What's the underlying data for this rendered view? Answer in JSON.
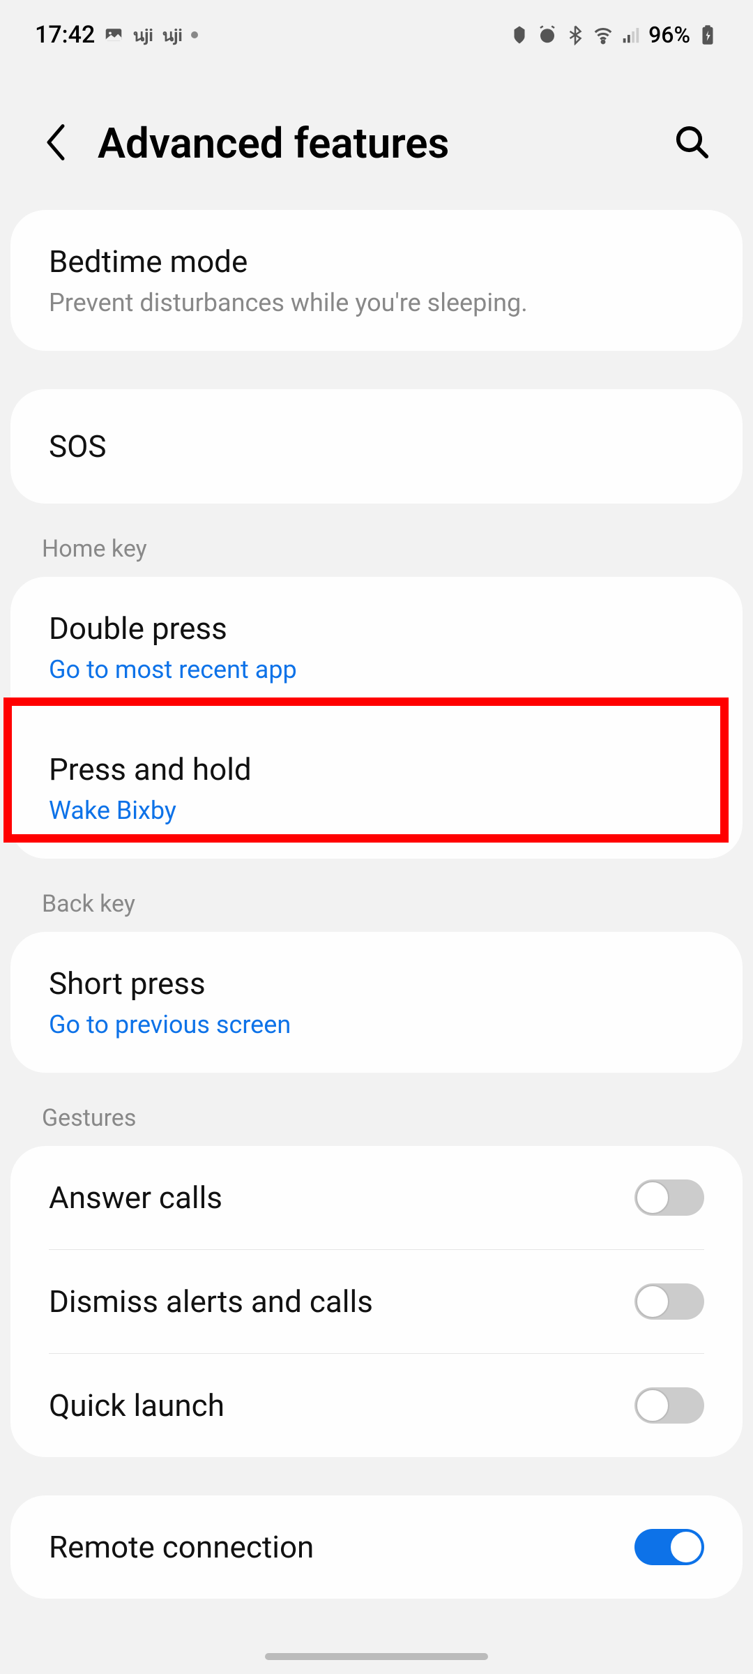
{
  "status": {
    "time": "17:42",
    "battery": "96%"
  },
  "header": {
    "title": "Advanced features"
  },
  "settings": {
    "bedtime": {
      "title": "Bedtime mode",
      "subtitle": "Prevent disturbances while you're sleeping."
    },
    "sos": {
      "title": "SOS"
    }
  },
  "sections": {
    "home_key": "Home key",
    "back_key": "Back key",
    "gestures": "Gestures"
  },
  "home_key": {
    "double_press": {
      "title": "Double press",
      "value": "Go to most recent app"
    },
    "press_hold": {
      "title": "Press and hold",
      "value": "Wake Bixby"
    }
  },
  "back_key": {
    "short_press": {
      "title": "Short press",
      "value": "Go to previous screen"
    }
  },
  "gestures": {
    "answer_calls": {
      "title": "Answer calls",
      "enabled": false
    },
    "dismiss_alerts": {
      "title": "Dismiss alerts and calls",
      "enabled": false
    },
    "quick_launch": {
      "title": "Quick launch",
      "enabled": false
    }
  },
  "remote": {
    "title": "Remote connection",
    "enabled": true
  },
  "highlight": {
    "target": "press-and-hold-item"
  }
}
